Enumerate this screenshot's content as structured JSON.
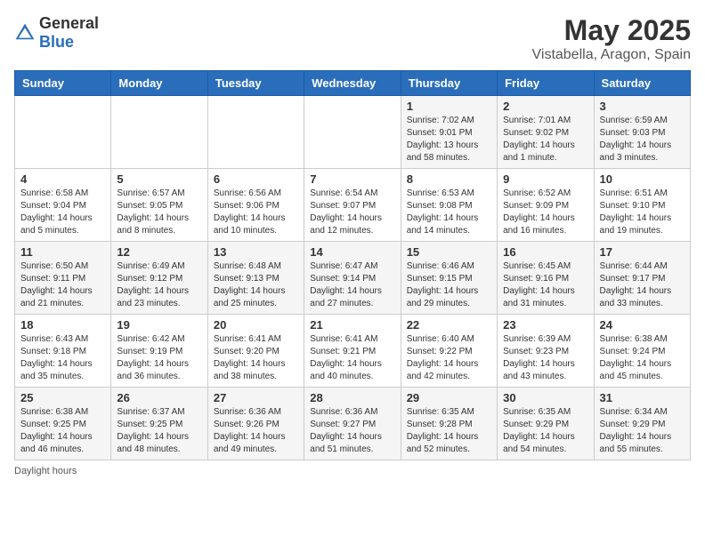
{
  "logo": {
    "general": "General",
    "blue": "Blue"
  },
  "title": "May 2025",
  "location": "Vistabella, Aragon, Spain",
  "days_header": [
    "Sunday",
    "Monday",
    "Tuesday",
    "Wednesday",
    "Thursday",
    "Friday",
    "Saturday"
  ],
  "weeks": [
    [
      {
        "day": "",
        "info": ""
      },
      {
        "day": "",
        "info": ""
      },
      {
        "day": "",
        "info": ""
      },
      {
        "day": "",
        "info": ""
      },
      {
        "day": "1",
        "info": "Sunrise: 7:02 AM\nSunset: 9:01 PM\nDaylight: 13 hours and 58 minutes."
      },
      {
        "day": "2",
        "info": "Sunrise: 7:01 AM\nSunset: 9:02 PM\nDaylight: 14 hours and 1 minute."
      },
      {
        "day": "3",
        "info": "Sunrise: 6:59 AM\nSunset: 9:03 PM\nDaylight: 14 hours and 3 minutes."
      }
    ],
    [
      {
        "day": "4",
        "info": "Sunrise: 6:58 AM\nSunset: 9:04 PM\nDaylight: 14 hours and 5 minutes."
      },
      {
        "day": "5",
        "info": "Sunrise: 6:57 AM\nSunset: 9:05 PM\nDaylight: 14 hours and 8 minutes."
      },
      {
        "day": "6",
        "info": "Sunrise: 6:56 AM\nSunset: 9:06 PM\nDaylight: 14 hours and 10 minutes."
      },
      {
        "day": "7",
        "info": "Sunrise: 6:54 AM\nSunset: 9:07 PM\nDaylight: 14 hours and 12 minutes."
      },
      {
        "day": "8",
        "info": "Sunrise: 6:53 AM\nSunset: 9:08 PM\nDaylight: 14 hours and 14 minutes."
      },
      {
        "day": "9",
        "info": "Sunrise: 6:52 AM\nSunset: 9:09 PM\nDaylight: 14 hours and 16 minutes."
      },
      {
        "day": "10",
        "info": "Sunrise: 6:51 AM\nSunset: 9:10 PM\nDaylight: 14 hours and 19 minutes."
      }
    ],
    [
      {
        "day": "11",
        "info": "Sunrise: 6:50 AM\nSunset: 9:11 PM\nDaylight: 14 hours and 21 minutes."
      },
      {
        "day": "12",
        "info": "Sunrise: 6:49 AM\nSunset: 9:12 PM\nDaylight: 14 hours and 23 minutes."
      },
      {
        "day": "13",
        "info": "Sunrise: 6:48 AM\nSunset: 9:13 PM\nDaylight: 14 hours and 25 minutes."
      },
      {
        "day": "14",
        "info": "Sunrise: 6:47 AM\nSunset: 9:14 PM\nDaylight: 14 hours and 27 minutes."
      },
      {
        "day": "15",
        "info": "Sunrise: 6:46 AM\nSunset: 9:15 PM\nDaylight: 14 hours and 29 minutes."
      },
      {
        "day": "16",
        "info": "Sunrise: 6:45 AM\nSunset: 9:16 PM\nDaylight: 14 hours and 31 minutes."
      },
      {
        "day": "17",
        "info": "Sunrise: 6:44 AM\nSunset: 9:17 PM\nDaylight: 14 hours and 33 minutes."
      }
    ],
    [
      {
        "day": "18",
        "info": "Sunrise: 6:43 AM\nSunset: 9:18 PM\nDaylight: 14 hours and 35 minutes."
      },
      {
        "day": "19",
        "info": "Sunrise: 6:42 AM\nSunset: 9:19 PM\nDaylight: 14 hours and 36 minutes."
      },
      {
        "day": "20",
        "info": "Sunrise: 6:41 AM\nSunset: 9:20 PM\nDaylight: 14 hours and 38 minutes."
      },
      {
        "day": "21",
        "info": "Sunrise: 6:41 AM\nSunset: 9:21 PM\nDaylight: 14 hours and 40 minutes."
      },
      {
        "day": "22",
        "info": "Sunrise: 6:40 AM\nSunset: 9:22 PM\nDaylight: 14 hours and 42 minutes."
      },
      {
        "day": "23",
        "info": "Sunrise: 6:39 AM\nSunset: 9:23 PM\nDaylight: 14 hours and 43 minutes."
      },
      {
        "day": "24",
        "info": "Sunrise: 6:38 AM\nSunset: 9:24 PM\nDaylight: 14 hours and 45 minutes."
      }
    ],
    [
      {
        "day": "25",
        "info": "Sunrise: 6:38 AM\nSunset: 9:25 PM\nDaylight: 14 hours and 46 minutes."
      },
      {
        "day": "26",
        "info": "Sunrise: 6:37 AM\nSunset: 9:25 PM\nDaylight: 14 hours and 48 minutes."
      },
      {
        "day": "27",
        "info": "Sunrise: 6:36 AM\nSunset: 9:26 PM\nDaylight: 14 hours and 49 minutes."
      },
      {
        "day": "28",
        "info": "Sunrise: 6:36 AM\nSunset: 9:27 PM\nDaylight: 14 hours and 51 minutes."
      },
      {
        "day": "29",
        "info": "Sunrise: 6:35 AM\nSunset: 9:28 PM\nDaylight: 14 hours and 52 minutes."
      },
      {
        "day": "30",
        "info": "Sunrise: 6:35 AM\nSunset: 9:29 PM\nDaylight: 14 hours and 54 minutes."
      },
      {
        "day": "31",
        "info": "Sunrise: 6:34 AM\nSunset: 9:29 PM\nDaylight: 14 hours and 55 minutes."
      }
    ]
  ],
  "footer": "Daylight hours"
}
